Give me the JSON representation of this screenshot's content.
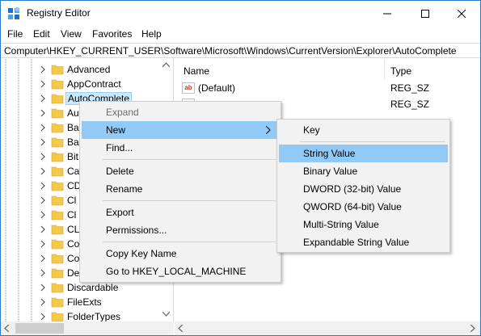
{
  "window": {
    "title": "Registry Editor"
  },
  "menubar": [
    "File",
    "Edit",
    "View",
    "Favorites",
    "Help"
  ],
  "address": "Computer\\HKEY_CURRENT_USER\\Software\\Microsoft\\Windows\\CurrentVersion\\Explorer\\AutoComplete",
  "tree": {
    "items": [
      {
        "label": "Advanced"
      },
      {
        "label": "AppContract"
      },
      {
        "label": "AutoComplete"
      },
      {
        "label": "Au"
      },
      {
        "label": "Ba"
      },
      {
        "label": "Ba"
      },
      {
        "label": "Bit"
      },
      {
        "label": "Ca"
      },
      {
        "label": "CD"
      },
      {
        "label": "Cl"
      },
      {
        "label": "Cl"
      },
      {
        "label": "CL"
      },
      {
        "label": "Co"
      },
      {
        "label": "Co"
      },
      {
        "label": "De"
      },
      {
        "label": "Discardable"
      },
      {
        "label": "FileExts"
      },
      {
        "label": "FolderTypes"
      }
    ]
  },
  "values": {
    "col_name": "Name",
    "col_type": "Type",
    "rows": [
      {
        "name": "(Default)",
        "type": "REG_SZ",
        "icon": "ab"
      },
      {
        "name": "",
        "type": "REG_SZ",
        "icon": "ab"
      }
    ]
  },
  "context_menu": {
    "expand": "Expand",
    "new": "New",
    "find": "Find...",
    "delete": "Delete",
    "rename": "Rename",
    "export": "Export",
    "permissions": "Permissions...",
    "copy_key_name": "Copy Key Name",
    "goto": "Go to HKEY_LOCAL_MACHINE"
  },
  "new_submenu": {
    "key": "Key",
    "string": "String Value",
    "binary": "Binary Value",
    "dword": "DWORD (32-bit) Value",
    "qword": "QWORD (64-bit) Value",
    "multi": "Multi-String Value",
    "expandable": "Expandable String Value"
  },
  "colors": {
    "selection": "#cce8ff",
    "menu_hover": "#91c9f7",
    "folder": "#f4c94a",
    "accent": "#2b79c9"
  }
}
